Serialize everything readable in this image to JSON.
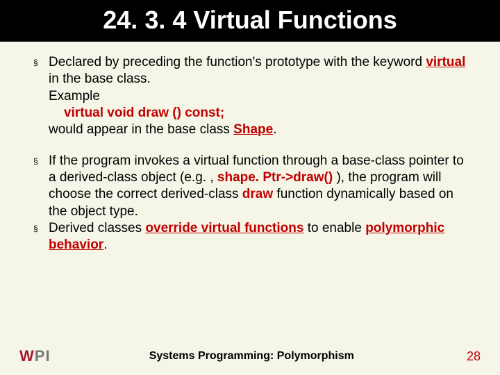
{
  "title": "24. 3. 4 Virtual Functions",
  "p1": {
    "pre": "Declared by preceding the function's prototype with the keyword ",
    "kw1": "virtual",
    "post": " in the base class."
  },
  "example_label": "Example",
  "code_line": "virtual void draw () const;",
  "p1b": {
    "pre": "would appear in the base class ",
    "kw": "Shape",
    "post": "."
  },
  "p2": {
    "a": "If the program invokes a virtual function through a base-class pointer to a derived-class object (e.g. , ",
    "kw1": "shape. Ptr->draw()",
    "b": " ), the program will choose the correct derived-class ",
    "kw2": "draw",
    "c": " function dynamically based on the object type."
  },
  "p3": {
    "a": "Derived classes ",
    "kw1": "override virtual functions",
    "b": " to enable ",
    "kw2": "polymorphic behavior",
    "c": "."
  },
  "footer": {
    "logo_w": "W",
    "logo_p": "P",
    "logo_i": "I",
    "title": "Systems Programming:  Polymorphism",
    "page": "28"
  },
  "bullet": "§"
}
